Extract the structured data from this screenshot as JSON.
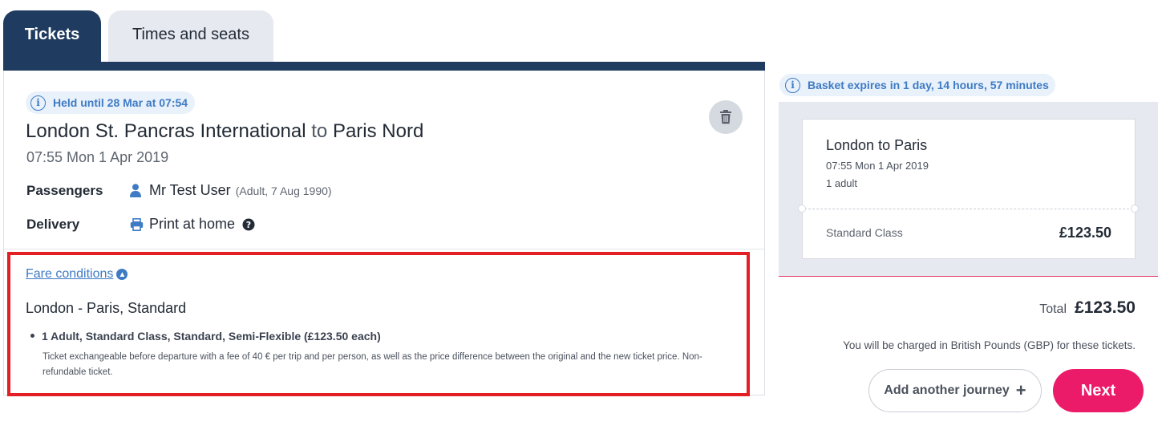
{
  "tabs": [
    {
      "label": "Tickets",
      "active": true
    },
    {
      "label": "Times and seats",
      "active": false
    }
  ],
  "journey": {
    "held_text": "Held until 28 Mar at 07:54",
    "origin": "London St. Pancras International",
    "connector": "to",
    "destination": "Paris Nord",
    "datetime": "07:55 Mon 1 Apr 2019",
    "passengers_label": "Passengers",
    "passenger_name": "Mr Test User",
    "passenger_detail": "(Adult, 7 Aug 1990)",
    "delivery_label": "Delivery",
    "delivery_value": "Print at home"
  },
  "fare": {
    "link_label": "Fare conditions",
    "heading": "London - Paris, Standard",
    "bullet": "1 Adult, Standard Class, Standard, Semi-Flexible (£123.50 each)",
    "description": "Ticket exchangeable before departure with a fee of 40 € per trip and per person, as well as the price difference between the original and the new ticket price. Non-refundable ticket."
  },
  "basket": {
    "expiry_text": "Basket expires in 1 day, 14 hours, 57 minutes",
    "ticket_title": "London to Paris",
    "ticket_datetime": "07:55 Mon 1 Apr 2019",
    "ticket_passengers": "1 adult",
    "ticket_class": "Standard Class",
    "ticket_price": "£123.50",
    "total_label": "Total",
    "total_value": "£123.50",
    "charge_note": "You will be charged in British Pounds (GBP) for these tickets.",
    "add_journey_label": "Add another journey",
    "next_label": "Next"
  },
  "icons": {
    "info": "info-icon",
    "trash": "trash-icon",
    "user": "user-icon",
    "printer": "printer-icon",
    "help": "help-icon",
    "arrow_up": "arrow-up-circle-icon",
    "plus": "plus-icon"
  },
  "colors": {
    "navy": "#1f3b5f",
    "accent_blue": "#3e7bc4",
    "highlight_red": "#e31e24",
    "cta_pink": "#ec1b6a"
  }
}
